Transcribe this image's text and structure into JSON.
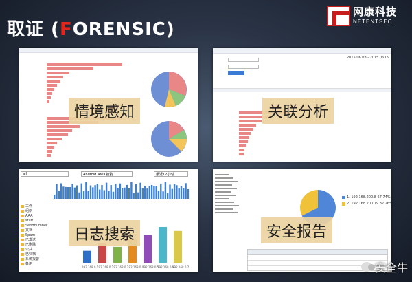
{
  "header": {
    "title_prefix": "取证 (",
    "title_highlight": "F",
    "title_suffix": "ORENSIC)"
  },
  "logo": {
    "cn": "网康科技",
    "en": "NETENTSEC"
  },
  "panels": {
    "situation": {
      "caption": "情境感知",
      "bar_color": "#e98686",
      "bar_values_top": [
        100,
        62,
        30,
        22,
        18,
        14,
        10,
        7,
        5,
        4
      ],
      "bar_values_bottom": [
        100,
        68,
        44,
        34,
        28,
        20,
        14,
        10,
        7,
        5
      ]
    },
    "correlation": {
      "caption": "关联分析",
      "range": "2015.06.03 - 2015.06.09",
      "bar_values": [
        90,
        55,
        40,
        30,
        25,
        20,
        18,
        15,
        12,
        10,
        8
      ]
    },
    "logsearch": {
      "caption": "日志搜索",
      "search_value": "all",
      "app_value": "Android AND 搜狗",
      "time_value": "最近12小时",
      "folders": [
        "工作",
        "组织",
        "AAA",
        "staff",
        "Sendnumber",
        "文档",
        "Spam",
        "已发送",
        "已删除",
        "公共",
        "已归档",
        "系统报警",
        "备用"
      ],
      "bar_values": [
        3,
        5,
        4,
        6,
        7,
        9,
        8
      ],
      "bar_colors": [
        "#2d6ec7",
        "#c94646",
        "#7fb34a",
        "#e48b1f",
        "#8f4bb7",
        "#4bb7c8",
        "#d9c84a"
      ],
      "bar_labels": [
        "192.168.0.1",
        "192.168.0.2",
        "192.168.0.3",
        "192.168.0.4",
        "192.168.0.5",
        "192.168.0.6",
        "192.168.0.7"
      ]
    },
    "report": {
      "caption": "安全报告",
      "legend": [
        {
          "label": "1. 192.168.200.8",
          "value": "67.74%",
          "color": "#4f86d8"
        },
        {
          "label": "2. 192.168.200.19",
          "value": "32.26%",
          "color": "#f0c23a"
        }
      ],
      "pie_values": [
        67.74,
        32.26
      ]
    }
  },
  "watermark": "安全牛"
}
